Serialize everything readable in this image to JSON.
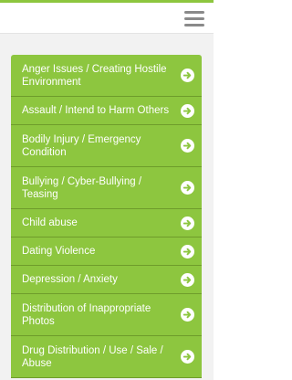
{
  "header": {
    "menu_icon": "hamburger-menu-icon"
  },
  "colors": {
    "accent": "#8dc63f",
    "item_border": "#6e9c2b",
    "icon_circle": "#ffffff",
    "background": "#f2f2f2"
  },
  "topics": [
    {
      "label": "Anger Issues / Creating Hostile Environment",
      "icon": "arrow-right-circle-icon"
    },
    {
      "label": "Assault / Intend to Harm Others",
      "icon": "arrow-right-circle-icon"
    },
    {
      "label": "Bodily Injury / Emergency Condition",
      "icon": "arrow-right-circle-icon"
    },
    {
      "label": "Bullying / Cyber-Bullying / Teasing",
      "icon": "arrow-right-circle-icon"
    },
    {
      "label": "Child abuse",
      "icon": "arrow-right-circle-icon"
    },
    {
      "label": "Dating Violence",
      "icon": "arrow-right-circle-icon"
    },
    {
      "label": "Depression / Anxiety",
      "icon": "arrow-right-circle-icon"
    },
    {
      "label": "Distribution of Inappropriate Photos",
      "icon": "arrow-right-circle-icon"
    },
    {
      "label": "Drug Distribution / Use / Sale / Abuse",
      "icon": "arrow-right-circle-icon"
    }
  ]
}
